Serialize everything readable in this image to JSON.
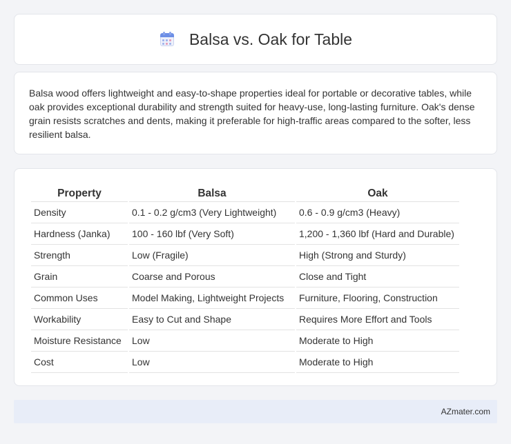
{
  "header": {
    "icon": "calendar-icon",
    "title": "Balsa vs. Oak for Table"
  },
  "description": "Balsa wood offers lightweight and easy-to-shape properties ideal for portable or decorative tables, while oak provides exceptional durability and strength suited for heavy-use, long-lasting furniture. Oak's dense grain resists scratches and dents, making it preferable for high-traffic areas compared to the softer, less resilient balsa.",
  "table": {
    "headers": [
      "Property",
      "Balsa",
      "Oak"
    ],
    "rows": [
      [
        "Density",
        "0.1 - 0.2 g/cm3 (Very Lightweight)",
        "0.6 - 0.9 g/cm3 (Heavy)"
      ],
      [
        "Hardness (Janka)",
        "100 - 160 lbf (Very Soft)",
        "1,200 - 1,360 lbf (Hard and Durable)"
      ],
      [
        "Strength",
        "Low (Fragile)",
        "High (Strong and Sturdy)"
      ],
      [
        "Grain",
        "Coarse and Porous",
        "Close and Tight"
      ],
      [
        "Common Uses",
        "Model Making, Lightweight Projects",
        "Furniture, Flooring, Construction"
      ],
      [
        "Workability",
        "Easy to Cut and Shape",
        "Requires More Effort and Tools"
      ],
      [
        "Moisture Resistance",
        "Low",
        "Moderate to High"
      ],
      [
        "Cost",
        "Low",
        "Moderate to High"
      ]
    ]
  },
  "footer": {
    "site": "AZmater.com"
  }
}
